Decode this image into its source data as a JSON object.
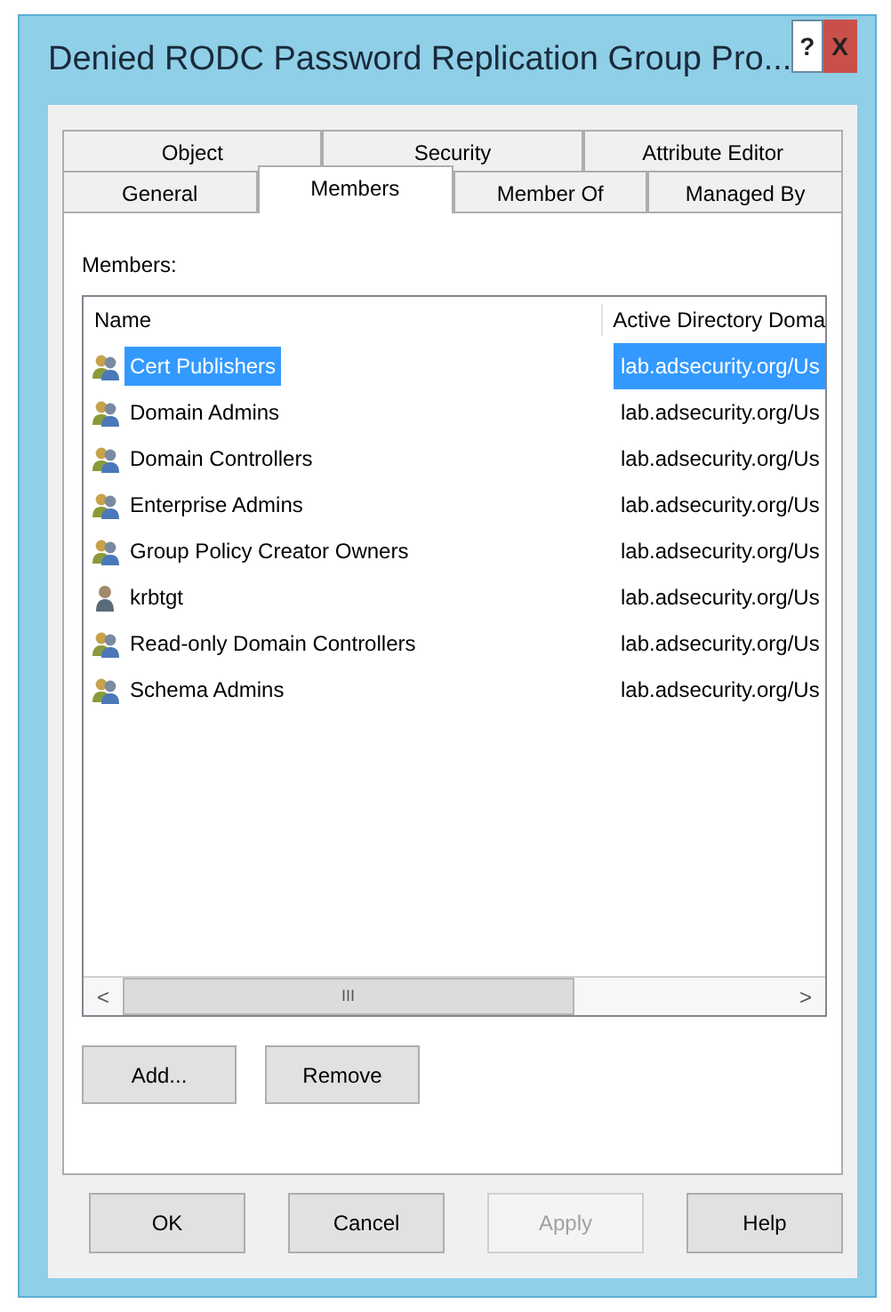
{
  "window": {
    "title": "Denied RODC Password Replication Group Pro...",
    "help": "?",
    "close": "X"
  },
  "tabs": [
    [
      {
        "label": "Object",
        "selected": false
      },
      {
        "label": "Security",
        "selected": false
      },
      {
        "label": "Attribute Editor",
        "selected": false
      }
    ],
    [
      {
        "label": "General",
        "selected": false
      },
      {
        "label": "Members",
        "selected": true
      },
      {
        "label": "Member Of",
        "selected": false
      },
      {
        "label": "Managed By",
        "selected": false
      }
    ]
  ],
  "members_label": "Members:",
  "list": {
    "columns": [
      "Name",
      "Active Directory Doma"
    ],
    "rows": [
      {
        "kind": "group",
        "name": "Cert Publishers",
        "domain": "lab.adsecurity.org/Us",
        "selected": true
      },
      {
        "kind": "group",
        "name": "Domain Admins",
        "domain": "lab.adsecurity.org/Us",
        "selected": false
      },
      {
        "kind": "group",
        "name": "Domain Controllers",
        "domain": "lab.adsecurity.org/Us",
        "selected": false
      },
      {
        "kind": "group",
        "name": "Enterprise Admins",
        "domain": "lab.adsecurity.org/Us",
        "selected": false
      },
      {
        "kind": "group",
        "name": "Group Policy Creator Owners",
        "domain": "lab.adsecurity.org/Us",
        "selected": false
      },
      {
        "kind": "user",
        "name": "krbtgt",
        "domain": "lab.adsecurity.org/Us",
        "selected": false
      },
      {
        "kind": "group",
        "name": "Read-only Domain Controllers",
        "domain": "lab.adsecurity.org/Us",
        "selected": false
      },
      {
        "kind": "group",
        "name": "Schema Admins",
        "domain": "lab.adsecurity.org/Us",
        "selected": false
      }
    ],
    "scroll_left": "<",
    "scroll_grip": "III",
    "scroll_right": ">"
  },
  "member_buttons": [
    {
      "label": "Add..."
    },
    {
      "label": "Remove"
    }
  ],
  "dialog_buttons": [
    {
      "label": "OK",
      "disabled": false
    },
    {
      "label": "Cancel",
      "disabled": false
    },
    {
      "label": "Apply",
      "disabled": true
    },
    {
      "label": "Help",
      "disabled": false
    }
  ]
}
